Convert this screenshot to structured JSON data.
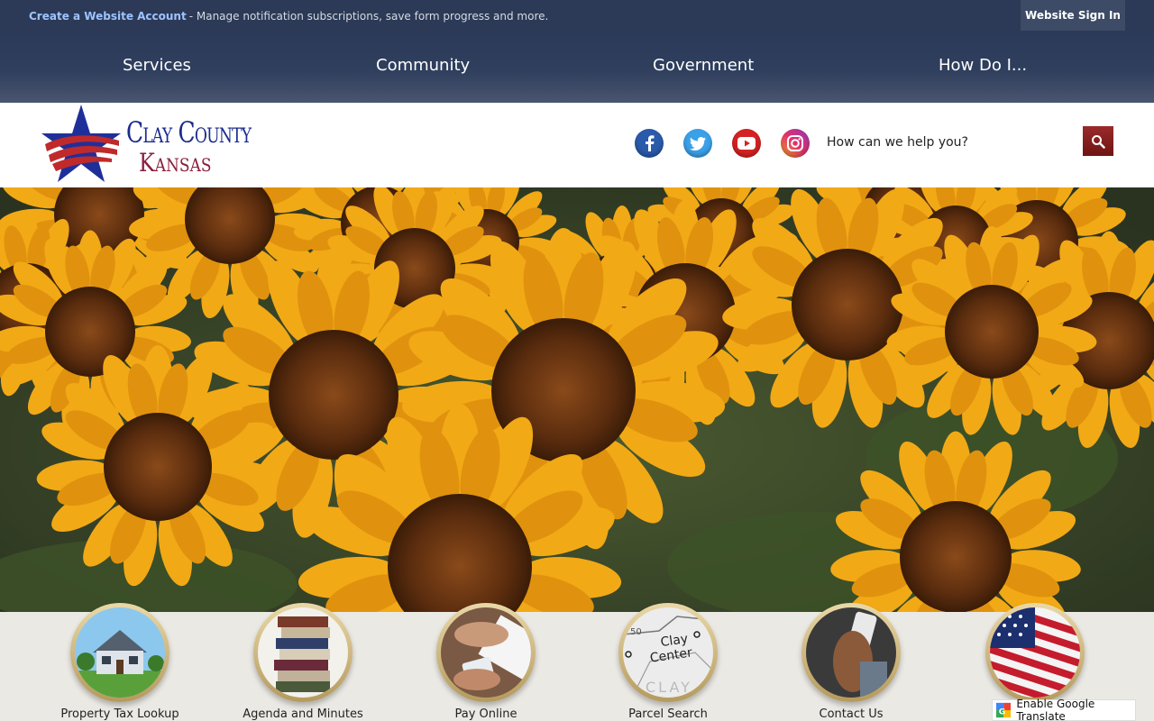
{
  "topbar": {
    "create_account": "Create a Website Account",
    "description": "- Manage notification subscriptions, save form progress and more.",
    "sign_in": "Website Sign In"
  },
  "nav": {
    "items": [
      "Services",
      "Community",
      "Government",
      "How Do I..."
    ]
  },
  "logo": {
    "line1": "Clay County",
    "line2": "Kansas"
  },
  "social": [
    "facebook-icon",
    "twitter-icon",
    "youtube-icon",
    "instagram-icon"
  ],
  "search": {
    "placeholder": "How can we help you?"
  },
  "quick_links": [
    {
      "label": "Property Tax Lookup",
      "icon": "house-photo"
    },
    {
      "label": "Agenda and Minutes",
      "icon": "books-photo"
    },
    {
      "label": "Pay Online",
      "icon": "credit-card-photo"
    },
    {
      "label": "Parcel Search",
      "icon": "map-photo"
    },
    {
      "label": "Contact Us",
      "icon": "phone-photo"
    },
    {
      "label": "",
      "icon": "flag-photo"
    }
  ],
  "map_text": {
    "line1": "Clay",
    "line2": "Center",
    "line3": "CLAY",
    "number": "50"
  },
  "translate": {
    "label": "Enable Google Translate"
  },
  "colors": {
    "topbar": "#2c3a57",
    "nav": "#2f3f5d",
    "search_button": "#8a2020",
    "link": "#9fc3ff"
  }
}
